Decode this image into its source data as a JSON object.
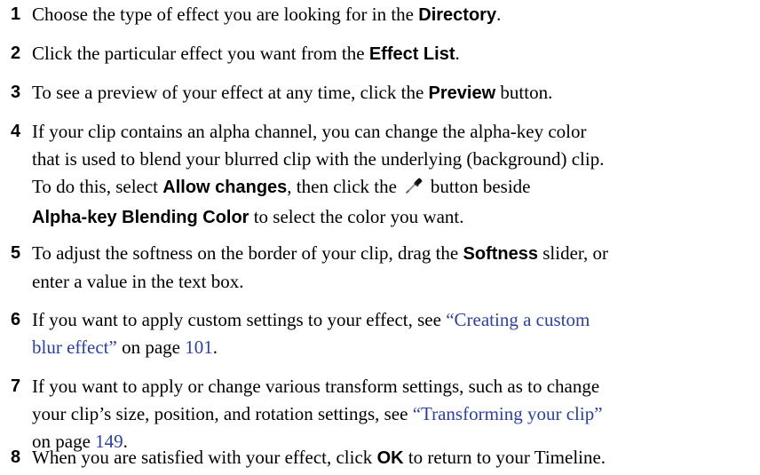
{
  "steps": [
    {
      "num": "1",
      "l1": {
        "a": "Choose the type of effect you are looking for in the ",
        "b": "Directory",
        "c": "."
      }
    },
    {
      "num": "2",
      "l1": {
        "a": "Click the particular effect you want from the ",
        "b": "Effect List",
        "c": "."
      }
    },
    {
      "num": "3",
      "l1": {
        "a": "To see a preview of your effect at any time, click the ",
        "b": "Preview",
        "c": " button."
      }
    },
    {
      "num": "4",
      "l1": "If your clip contains an alpha channel, you can change the alpha-key color",
      "l2": "that is used to blend your blurred clip with the underlying (background) clip.",
      "l3": {
        "a": "To do this, select ",
        "b": "Allow changes",
        "c": ", then click the",
        "d": "button beside"
      },
      "l4": {
        "a": "Alpha-key Blending Color",
        "b": " to select the color you want."
      },
      "icon": "eyedropper-icon"
    },
    {
      "num": "5",
      "l1": {
        "a": "To adjust the softness on the border of your clip, drag the ",
        "b": "Softness",
        "c": " slider, or"
      },
      "l2": "enter a value in the text box."
    },
    {
      "num": "6",
      "l1": {
        "a": "If you want to apply custom settings to your effect, see ",
        "link": "“Creating a custom"
      },
      "l2": {
        "link": "blur effect”",
        "b": " on page ",
        "page": "101",
        "c": "."
      }
    },
    {
      "num": "7",
      "l1": "If you want to apply or change various transform settings, such as to change",
      "l2": {
        "a": "your clip’s size, position, and rotation settings, see ",
        "link": "“Transforming your clip”"
      },
      "l3": {
        "a": "on page ",
        "page": "149",
        "b": "."
      }
    },
    {
      "num": "8",
      "l1": {
        "a": "When you are satisfied with your effect, click ",
        "b": "OK",
        "c": " to return to your Timeline."
      }
    }
  ],
  "colors": {
    "text": "#000000",
    "link": "#2a3fa8",
    "background": "#ffffff"
  }
}
